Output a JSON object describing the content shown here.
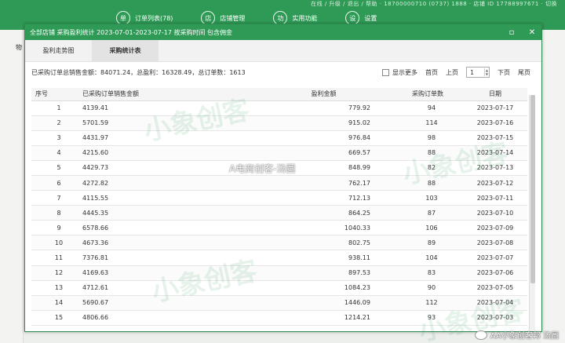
{
  "background": {
    "info_text": "在线 / 升级 / 退出 / 帮助 · 18700000710 (0737) 1888 · 店铺 ID 17788997671 · 切换",
    "left_label": "物",
    "nav": [
      {
        "icon": "单",
        "label": "订单列表(78)"
      },
      {
        "icon": "店",
        "label": "店铺管理"
      },
      {
        "icon": "功",
        "label": "实用功能"
      },
      {
        "icon": "设",
        "label": "设置"
      }
    ]
  },
  "modal": {
    "title": "全部店铺 采购盈利统计 2023-07-01-2023-07-17 按采购时间 包含佣金",
    "tabs": [
      {
        "label": "盈利走势图",
        "active": false
      },
      {
        "label": "采购统计表",
        "active": true
      }
    ],
    "summary": "已采购订单总销售金额：84071.24，总盈利：16328.49，总订单数：1613",
    "pager": {
      "show_more": "显示更多",
      "first": "首页",
      "prev": "上页",
      "page": "1",
      "next": "下页",
      "last": "尾页"
    },
    "table": {
      "headers": [
        "序号",
        "已采购订单销售金额",
        "盈利金额",
        "采购订单数",
        "日期"
      ],
      "rows": [
        [
          "1",
          "4139.41",
          "779.92",
          "94",
          "2023-07-17"
        ],
        [
          "2",
          "5701.59",
          "915.02",
          "114",
          "2023-07-16"
        ],
        [
          "3",
          "4431.97",
          "976.84",
          "98",
          "2023-07-15"
        ],
        [
          "4",
          "4215.60",
          "669.57",
          "88",
          "2023-07-14"
        ],
        [
          "5",
          "4429.73",
          "848.99",
          "82",
          "2023-07-13"
        ],
        [
          "6",
          "4272.82",
          "762.17",
          "88",
          "2023-07-12"
        ],
        [
          "7",
          "4115.55",
          "712.13",
          "103",
          "2023-07-11"
        ],
        [
          "8",
          "4445.35",
          "864.25",
          "87",
          "2023-07-10"
        ],
        [
          "9",
          "6578.66",
          "1040.33",
          "106",
          "2023-07-09"
        ],
        [
          "10",
          "4673.36",
          "802.75",
          "89",
          "2023-07-08"
        ],
        [
          "11",
          "7376.81",
          "938.11",
          "104",
          "2023-07-07"
        ],
        [
          "12",
          "4169.63",
          "897.53",
          "83",
          "2023-07-06"
        ],
        [
          "13",
          "4712.61",
          "1084.23",
          "90",
          "2023-07-05"
        ],
        [
          "14",
          "5690.67",
          "1446.09",
          "112",
          "2023-07-04"
        ],
        [
          "15",
          "4806.66",
          "1214.21",
          "93",
          "2023-07-03"
        ]
      ]
    }
  },
  "overlay": {
    "center_text": "A电商创客-汤圆",
    "credit_text": "AA小象创客邦 汤圆"
  },
  "watermark_text": "小象创客",
  "colors": {
    "brand_green": "#2f9a56",
    "header_bg": "#f5f5f5"
  }
}
